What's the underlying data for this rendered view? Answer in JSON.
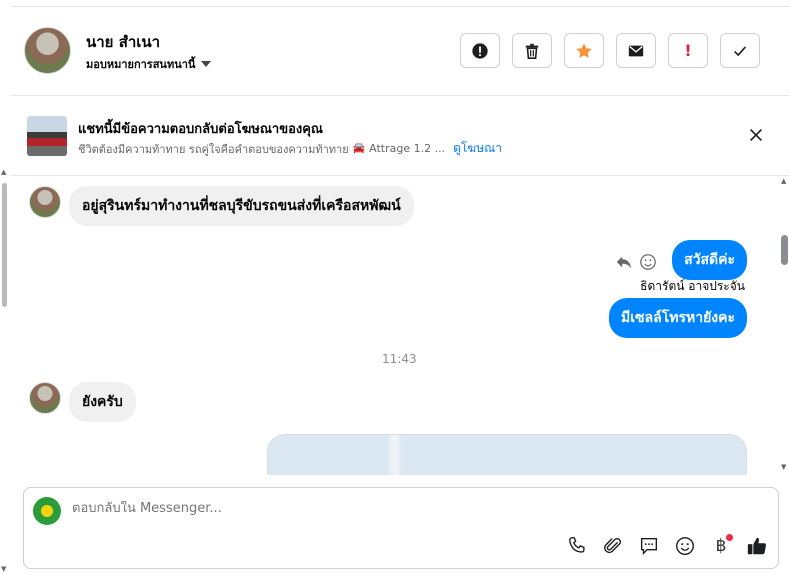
{
  "header": {
    "contact_name": "นาย สำเนา",
    "assign_label": "มอบหมายการสนทนานี้",
    "actions": [
      "alert-icon",
      "trash-icon",
      "star-icon",
      "mail-icon",
      "exclamation-icon",
      "check-icon"
    ],
    "exclamation_glyph": "!"
  },
  "ad": {
    "title": "แชทนี้มีข้อความตอบกลับต่อโฆษณาของคุณ",
    "subtitle": "ชีวิตต้องมีความท้าทาย รถคู่ใจคือคำตอบของความท้าทาย",
    "car_model": "Attrage 1.2 ...",
    "link": "ดูโฆษณา"
  },
  "messages": [
    {
      "from": "customer",
      "text": "อยู่สุรินทร์มาทำงานที่ชลบุรีขับรถขนส่งที่เครือสหพัฒน์"
    },
    {
      "from": "page",
      "text": "สวัสดีค่ะ"
    },
    {
      "from": "page",
      "sender": "ธิดารัตน์ อาจประจัน",
      "text": "มีเซลล์โทรหายังคะ"
    },
    {
      "time": "11:43"
    },
    {
      "from": "customer",
      "text": "ยังครับ"
    }
  ],
  "composer": {
    "placeholder": "ตอบกลับใน Messenger...",
    "baht_glyph": "฿",
    "tools": [
      "phone-icon",
      "paperclip-icon",
      "chat-icon",
      "emoji-icon",
      "baht-icon",
      "like-icon"
    ]
  },
  "colors": {
    "accent": "#0084ff",
    "incoming_bubble": "#f0f0f0",
    "alert_red": "#e41e3f",
    "star_orange": "#f7923a"
  }
}
